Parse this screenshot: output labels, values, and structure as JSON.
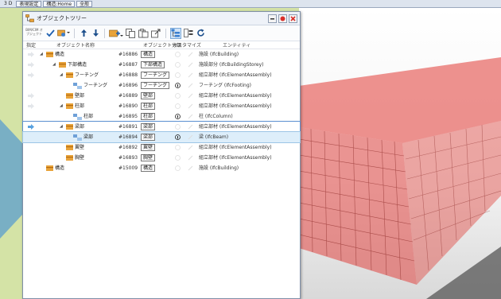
{
  "app_tabs": [
    "3 D",
    "表現設定",
    "構造:Home",
    "全般"
  ],
  "panel": {
    "title": "オブジェクトツリー",
    "toolbar_small_label": "BIM/CIM オブジェクト"
  },
  "columns": {
    "designate": "指定",
    "name": "オブジェクト名称",
    "classification": "オブジェクト分類",
    "customize": "カスタマイズ",
    "entity": "エンティティ"
  },
  "rows": [
    {
      "name": "構造",
      "id": "#16886",
      "cls": "構造",
      "entity": "施設 (IfcBuilding)"
    },
    {
      "name": "下部構造",
      "id": "#16887",
      "cls": "下部構造",
      "entity": "施設部分 (IfcBuildingStorey)"
    },
    {
      "name": "フーチング",
      "id": "#16888",
      "cls": "フーチング",
      "entity": "組立部材 (IfcElementAssembly)"
    },
    {
      "name": "フーチング",
      "id": "#16896",
      "cls": "フーチング",
      "entity": "フーチング (IfcFooting)"
    },
    {
      "name": "壁部",
      "id": "#16889",
      "cls": "壁部",
      "entity": "組立部材 (IfcElementAssembly)"
    },
    {
      "name": "柱部",
      "id": "#16890",
      "cls": "柱部",
      "entity": "組立部材 (IfcElementAssembly)"
    },
    {
      "name": "柱部",
      "id": "#16895",
      "cls": "柱部",
      "entity": "柱 (IfcColumn)"
    },
    {
      "name": "梁部",
      "id": "#16891",
      "cls": "梁部",
      "entity": "組立部材 (IfcElementAssembly)"
    },
    {
      "name": "梁部",
      "id": "#16894",
      "cls": "梁部",
      "entity": "梁 (IfcBeam)"
    },
    {
      "name": "翼壁",
      "id": "#16892",
      "cls": "翼壁",
      "entity": "組立部材 (IfcElementAssembly)"
    },
    {
      "name": "胸壁",
      "id": "#16893",
      "cls": "胸壁",
      "entity": "組立部材 (IfcElementAssembly)"
    },
    {
      "name": "構造",
      "id": "#15009",
      "cls": "構造",
      "entity": "施設 (IfcBuilding)"
    }
  ],
  "colors": {
    "accent": "#5a8fd0",
    "selected_row": "#ddeefa",
    "model_red": "#e0443f",
    "close_red": "#d9302a"
  }
}
